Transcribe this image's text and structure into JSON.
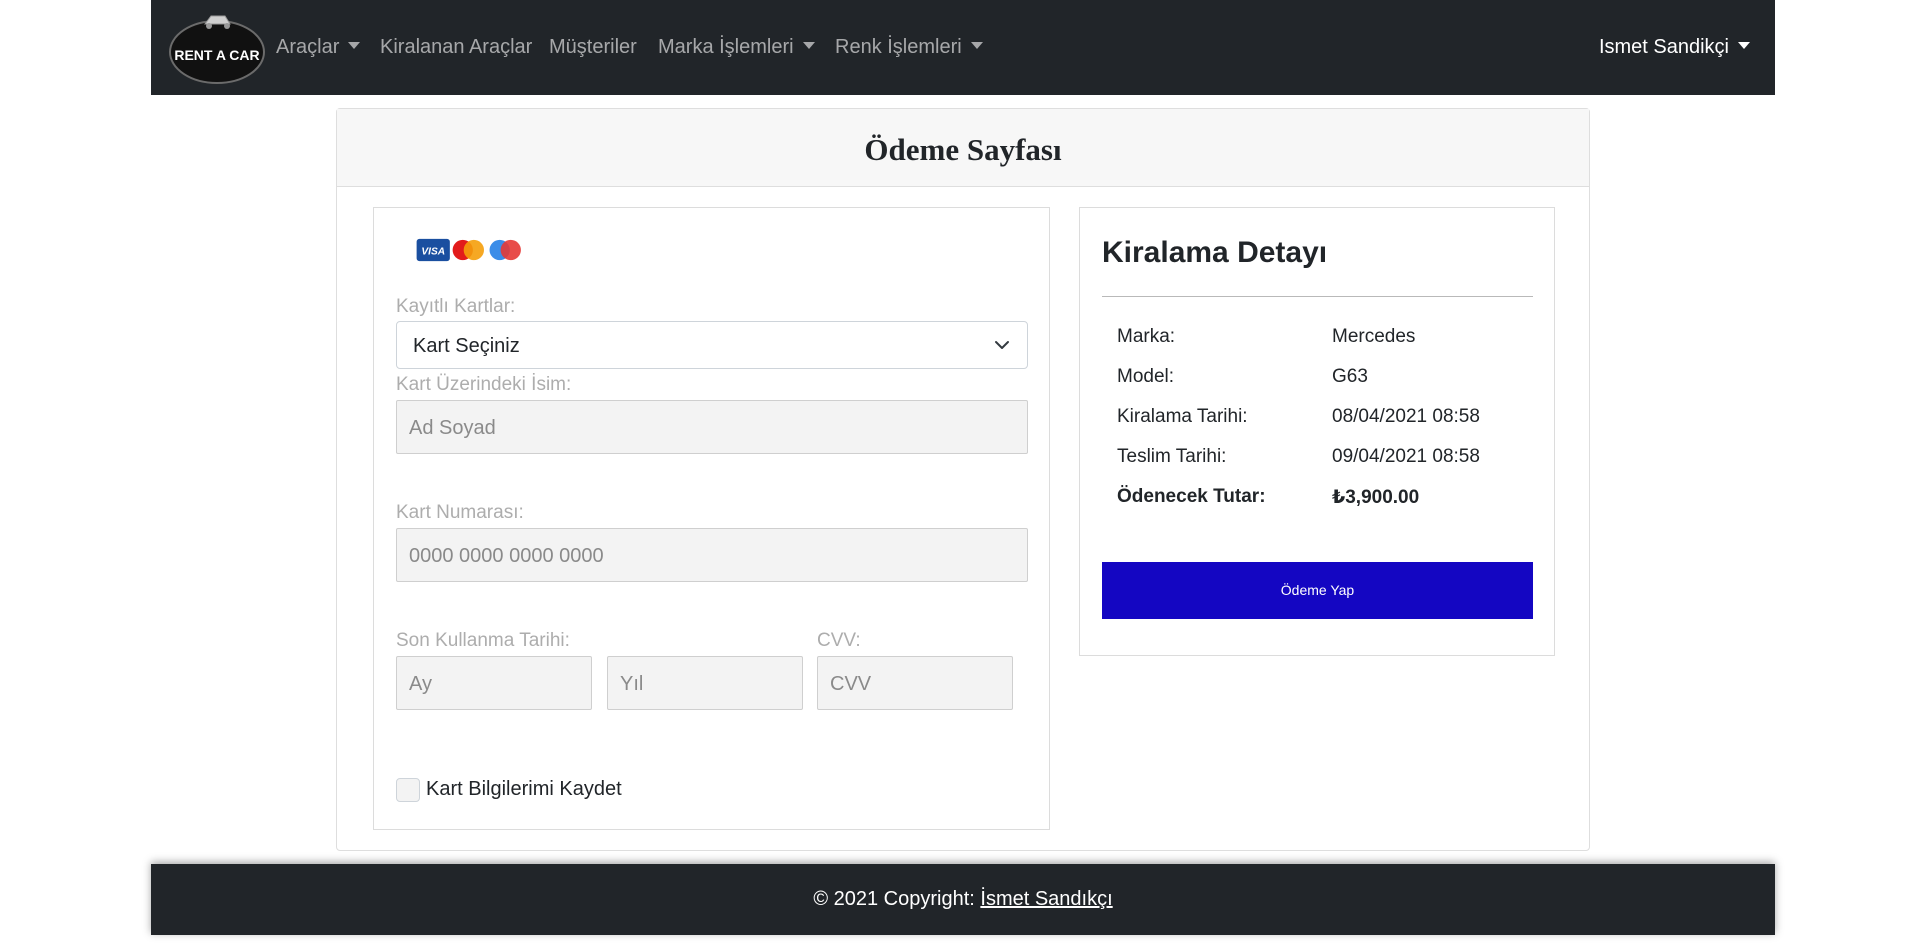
{
  "navbar": {
    "logo_text": "RENT A CAR",
    "items": [
      {
        "label": "Araçlar",
        "dropdown": true
      },
      {
        "label": "Kiralanan Araçlar",
        "dropdown": false
      },
      {
        "label": "Müşteriler",
        "dropdown": false
      },
      {
        "label": "Marka İşlemleri",
        "dropdown": true
      },
      {
        "label": "Renk İşlemleri",
        "dropdown": true
      }
    ],
    "user": "Ismet Sandikçi"
  },
  "page": {
    "title": "Ödeme Sayfası"
  },
  "payment_form": {
    "card_brand_icons": [
      "visa-icon",
      "mastercard-icon",
      "maestro-icon"
    ],
    "saved_cards_label": "Kayıtlı Kartlar:",
    "saved_cards_selected": "Kart Seçiniz",
    "name_label": "Kart Üzerindeki İsim:",
    "name_placeholder": "Ad Soyad",
    "number_label": "Kart Numarası:",
    "number_placeholder": "0000 0000 0000 0000",
    "expiry_label": "Son Kullanma Tarihi:",
    "month_placeholder": "Ay",
    "year_placeholder": "Yıl",
    "cvv_label": "CVV:",
    "cvv_placeholder": "CVV",
    "save_card_label": "Kart Bilgilerimi Kaydet"
  },
  "rental_detail": {
    "title": "Kiralama Detayı",
    "rows": [
      {
        "key": "Marka:",
        "value": "Mercedes"
      },
      {
        "key": "Model:",
        "value": "G63"
      },
      {
        "key": "Kiralama Tarihi:",
        "value": "08/04/2021 08:58"
      },
      {
        "key": "Teslim Tarihi:",
        "value": "09/04/2021 08:58"
      },
      {
        "key": "Ödenecek Tutar:",
        "value": "₺3,900.00"
      }
    ],
    "pay_button_label": "Ödeme Yap",
    "pay_button_color": "#1406c2"
  },
  "footer": {
    "copyright_text": "© 2021 Copyright: ",
    "author_link": "İsmet Sandıkçı"
  },
  "colors": {
    "navbar_bg": "#212529",
    "footer_bg": "#212529",
    "accent": "#1406c2"
  }
}
